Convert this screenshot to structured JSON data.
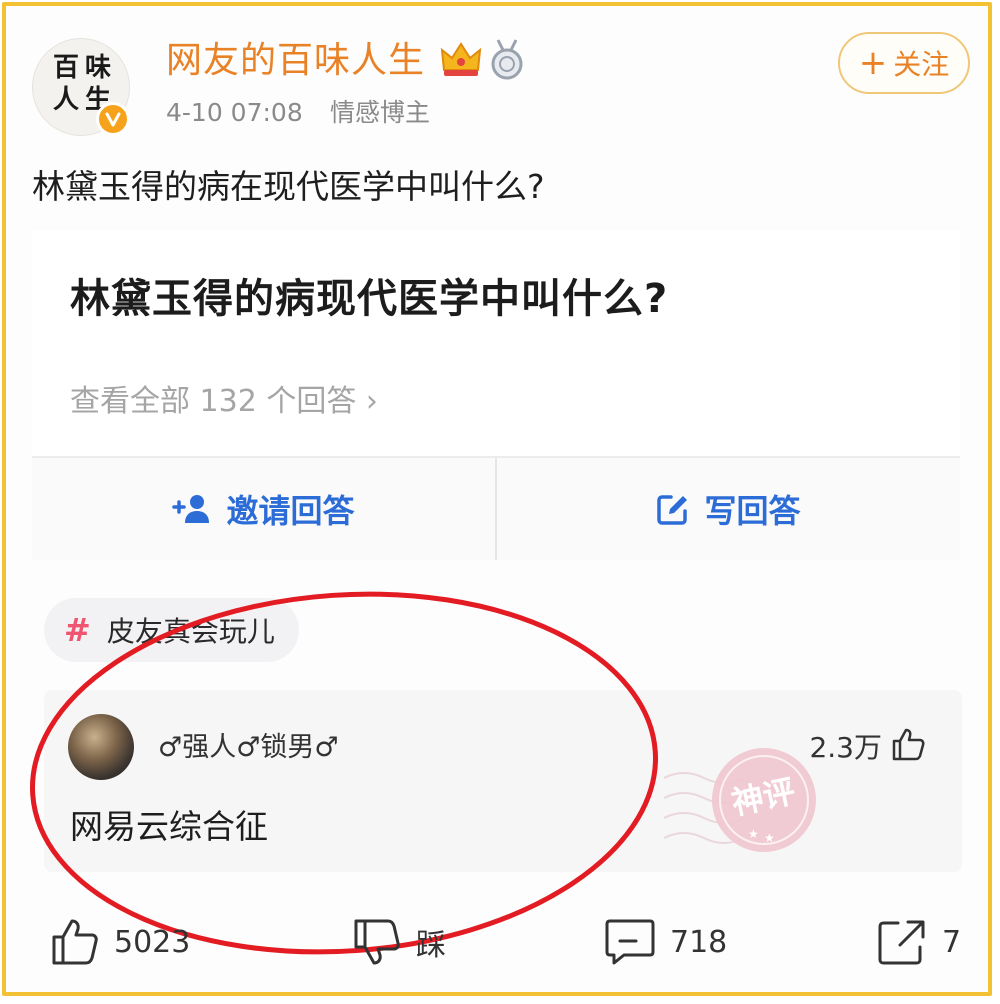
{
  "author": {
    "name": "网友的百味人生",
    "avatar_text": [
      "百",
      "味",
      "人",
      "生"
    ],
    "time": "4-10 07:08",
    "role": "情感博主"
  },
  "follow_button": {
    "plus": "+",
    "label": "关注"
  },
  "post": {
    "text": "林黛玉得的病在现代医学中叫什么?"
  },
  "question_card": {
    "title": "林黛玉得的病现代医学中叫什么?",
    "view_all": "查看全部 132 个回答 ›",
    "invite_label": "邀请回答",
    "write_label": "写回答"
  },
  "tag": {
    "hash": "#",
    "label": "皮友真会玩儿"
  },
  "hot_comment": {
    "user": "♂强人♂锁男♂",
    "likes": "2.3万",
    "text": "网易云综合征",
    "stamp_text": "神评"
  },
  "actions": {
    "like_count": "5023",
    "dislike_label": "踩",
    "comment_count": "718",
    "share_count": "7"
  },
  "colors": {
    "frame": "#f3c234",
    "username": "#e98226",
    "link_blue": "#2c6cd6",
    "hashtag": "#ef5470",
    "annotation": "#e31b23"
  }
}
